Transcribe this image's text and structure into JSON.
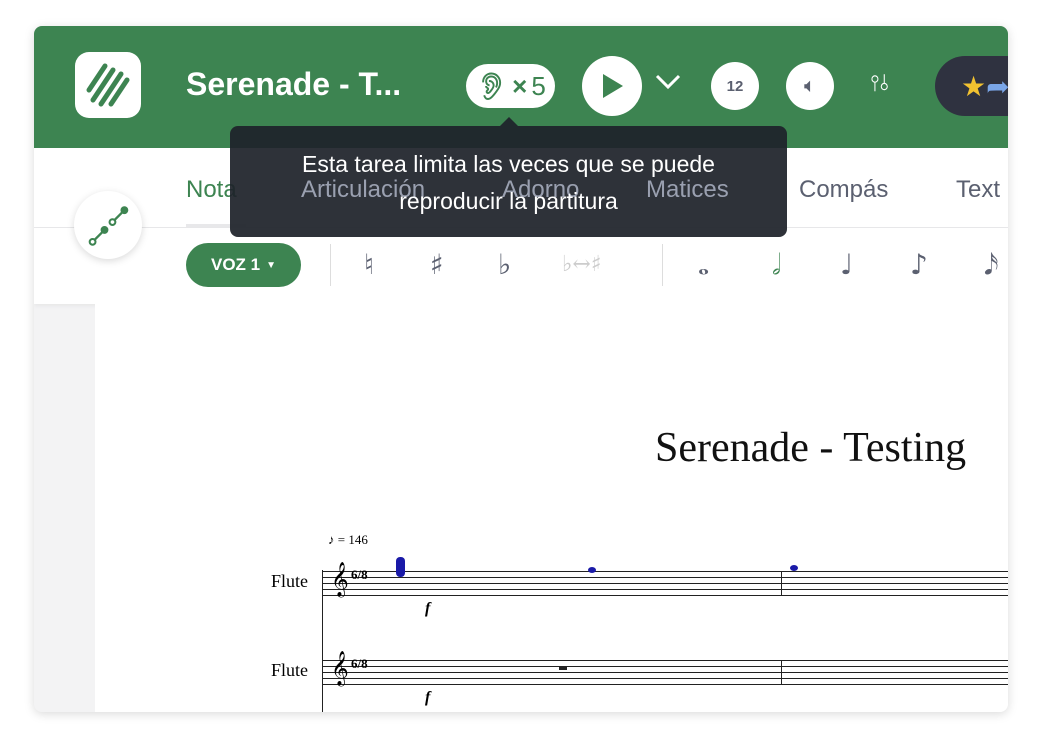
{
  "header": {
    "title": "Serenade - T...",
    "play_limit_symbol": "×",
    "play_limit_count": "5",
    "metronome_label": "12"
  },
  "tooltip": {
    "line1": "Esta tarea limita las veces que se puede",
    "line2": "reproducir la partitura"
  },
  "tabs": [
    {
      "label": "Nota",
      "active": true
    },
    {
      "label": "Articulación"
    },
    {
      "label": "Adorno"
    },
    {
      "label": "Matices"
    },
    {
      "label": "Compás"
    },
    {
      "label": "Text"
    }
  ],
  "toolbar": {
    "voice": "VOZ 1",
    "accidentals": [
      "♮",
      "♯",
      "♭",
      "♭↔♯"
    ],
    "durations": [
      "𝅝",
      "𝅗𝅥",
      "♩",
      "♪",
      "𝅘𝅥𝅯"
    ]
  },
  "score": {
    "title": "Serenade - Testing",
    "tempo": "♪ = 146",
    "instruments": [
      "Flute",
      "Flute"
    ],
    "time_signature": "6/8",
    "dynamic": "f"
  },
  "colors": {
    "brand": "#3d8451",
    "note_highlight": "#1a1aa8"
  }
}
